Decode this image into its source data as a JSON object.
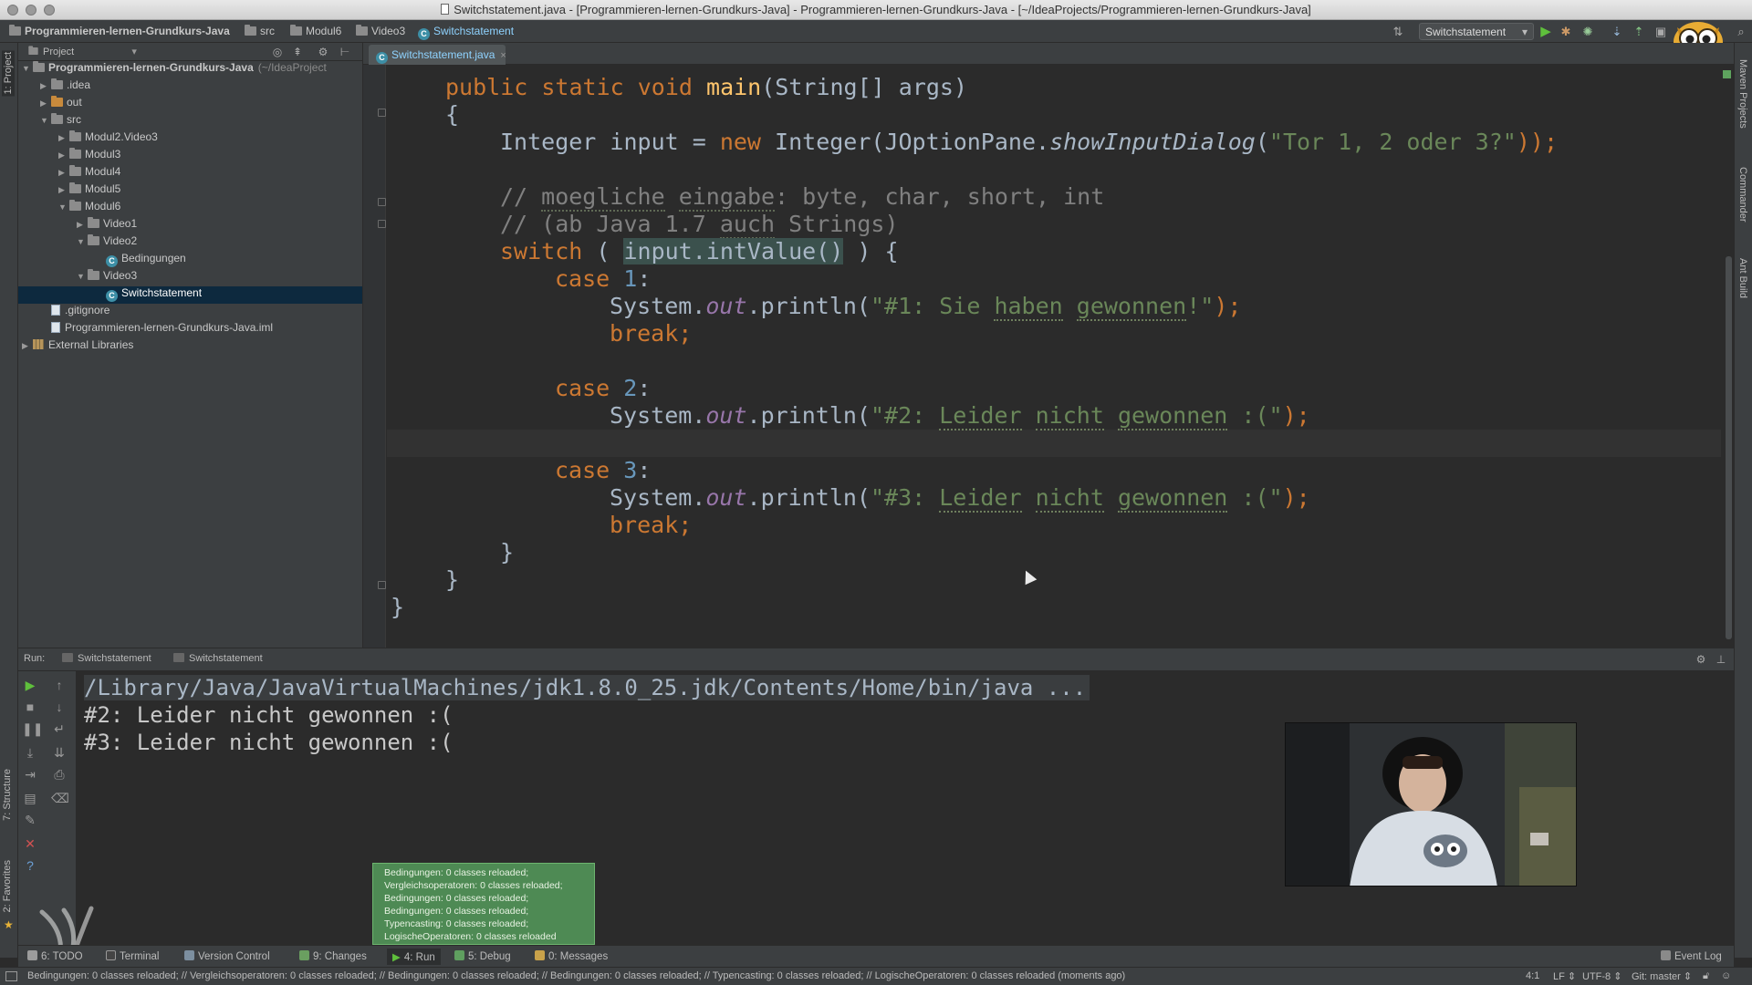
{
  "window": {
    "title": "Switchstatement.java - [Programmieren-lernen-Grundkurs-Java] - Programmieren-lernen-Grundkurs-Java - [~/IdeaProjects/Programmieren-lernen-Grundkurs-Java]"
  },
  "navbar": {
    "crumbs": [
      "Programmieren-lernen-Grundkurs-Java",
      "src",
      "Modul6",
      "Video3",
      "Switchstatement"
    ],
    "run_config": "Switchstatement"
  },
  "left_strip": {
    "tabs": [
      "1: Project",
      "7: Structure",
      "2: Favorites"
    ]
  },
  "right_strip": {
    "tabs": [
      "Maven Projects",
      "Commander",
      "Ant Build"
    ]
  },
  "project_panel": {
    "header": "Project",
    "tree": [
      {
        "label": "Programmieren-lernen-Grundkurs-Java",
        "suffix": "(~/IdeaProject",
        "indent": 0,
        "arrow": "down",
        "icon": "folder"
      },
      {
        "label": ".idea",
        "indent": 1,
        "arrow": "right",
        "icon": "folder"
      },
      {
        "label": "out",
        "indent": 1,
        "arrow": "right",
        "icon": "folder-orange"
      },
      {
        "label": "src",
        "indent": 1,
        "arrow": "down",
        "icon": "folder"
      },
      {
        "label": "Modul2.Video3",
        "indent": 2,
        "arrow": "right",
        "icon": "folder"
      },
      {
        "label": "Modul3",
        "indent": 2,
        "arrow": "right",
        "icon": "folder"
      },
      {
        "label": "Modul4",
        "indent": 2,
        "arrow": "right",
        "icon": "folder"
      },
      {
        "label": "Modul5",
        "indent": 2,
        "arrow": "right",
        "icon": "folder"
      },
      {
        "label": "Modul6",
        "indent": 2,
        "arrow": "down",
        "icon": "folder"
      },
      {
        "label": "Video1",
        "indent": 3,
        "arrow": "right",
        "icon": "folder"
      },
      {
        "label": "Video2",
        "indent": 3,
        "arrow": "down",
        "icon": "folder"
      },
      {
        "label": "Bedingungen",
        "indent": 4,
        "arrow": "",
        "icon": "class"
      },
      {
        "label": "Video3",
        "indent": 3,
        "arrow": "down",
        "icon": "folder"
      },
      {
        "label": "Switchstatement",
        "indent": 4,
        "arrow": "",
        "icon": "class",
        "selected": true
      },
      {
        "label": ".gitignore",
        "indent": 1,
        "arrow": "",
        "icon": "file"
      },
      {
        "label": "Programmieren-lernen-Grundkurs-Java.iml",
        "indent": 1,
        "arrow": "",
        "icon": "file"
      },
      {
        "label": "External Libraries",
        "indent": 0,
        "arrow": "right",
        "icon": "lib"
      }
    ]
  },
  "editor": {
    "tab": "Switchstatement.java",
    "code": {
      "l1": [
        "public",
        "static",
        "void",
        "main",
        "(String[] args)"
      ],
      "l2": "{",
      "l3": [
        "Integer input = ",
        "new",
        " Integer(JOptionPane.",
        "showInputDialog",
        "(",
        "\"Tor 1, 2 oder 3?\"",
        "));"
      ],
      "l4": [
        "// ",
        "moegliche",
        " ",
        "eingabe",
        ": byte, char, short, int"
      ],
      "l5": [
        "// (ab Java 1.7 ",
        "auch",
        " Strings)"
      ],
      "l6": [
        "switch",
        " ( ",
        "input.intValue()",
        " ) {"
      ],
      "l7": [
        "case",
        " ",
        "1",
        ":"
      ],
      "l8": [
        "System.",
        "out",
        ".println(",
        "\"#1: Sie ",
        "haben",
        " ",
        "gewonnen",
        "!\"",
        ");"
      ],
      "l9": [
        "break",
        ";"
      ],
      "l10": [
        "case",
        " ",
        "2",
        ":"
      ],
      "l11": [
        "System.",
        "out",
        ".println(",
        "\"#2: ",
        "Leider",
        " ",
        "nicht",
        " ",
        "gewonnen",
        " :(\"",
        ");"
      ],
      "l12": [
        "case",
        " ",
        "3",
        ":"
      ],
      "l13": [
        "System.",
        "out",
        ".println(",
        "\"#3: ",
        "Leider",
        " ",
        "nicht",
        " ",
        "gewonnen",
        " :(\"",
        ");"
      ],
      "l14": [
        "break",
        ";"
      ],
      "l15": "}",
      "l16": "}",
      "l17": "}"
    }
  },
  "run_panel": {
    "label": "Run:",
    "tabs": [
      "Switchstatement",
      "Switchstatement"
    ],
    "console": [
      "/Library/Java/JavaVirtualMachines/jdk1.8.0_25.jdk/Contents/Home/bin/java ...",
      "#2: Leider nicht gewonnen :(",
      "#3: Leider nicht gewonnen :("
    ]
  },
  "balloon": {
    "lines": [
      "Bedingungen: 0 classes reloaded;",
      "Vergleichsoperatoren: 0 classes reloaded;",
      "Bedingungen: 0 classes reloaded;",
      "Bedingungen: 0 classes reloaded;",
      "Typencasting: 0 classes reloaded;",
      "LogischeOperatoren: 0 classes reloaded"
    ]
  },
  "tool_windows": {
    "todo": "6: TODO",
    "terminal": "Terminal",
    "vcs": "Version Control",
    "changes": "9: Changes",
    "run": "4: Run",
    "debug": "5: Debug",
    "messages": "0: Messages",
    "event_log": "Event Log"
  },
  "status_bar": {
    "message": "Bedingungen: 0 classes reloaded; // Vergleichsoperatoren: 0 classes reloaded; // Bedingungen: 0 classes reloaded; // Bedingungen: 0 classes reloaded; // Typencasting: 0 classes reloaded; // LogischeOperatoren: 0 classes reloaded (moments ago)",
    "position": "4:1",
    "line_sep": "LF",
    "encoding": "UTF-8",
    "vcs": "Git: master"
  },
  "colors": {
    "background": "#2b2b2b",
    "panel": "#3c3f41",
    "keyword": "#cc7832",
    "string": "#6a8759",
    "number": "#6897bb",
    "comment": "#808080",
    "method": "#ffc66d",
    "field": "#9876aa",
    "selection": "#0d293e",
    "balloon": "#4e8a54"
  },
  "icons": [
    "gear-icon",
    "run-icon",
    "debug-icon",
    "stop-icon",
    "pause-icon",
    "close-icon",
    "help-icon",
    "owl-avatar-icon"
  ]
}
